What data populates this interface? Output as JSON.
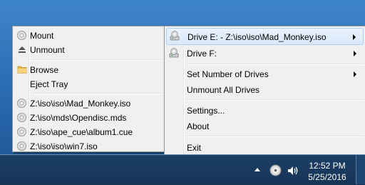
{
  "left_menu": {
    "mount": "Mount",
    "unmount": "Unmount",
    "browse": "Browse",
    "eject_tray": "Eject Tray",
    "recent": [
      "Z:\\iso\\iso\\Mad_Monkey.iso",
      "Z:\\iso\\mds\\Opendisc.mds",
      "Z:\\iso\\ape_cue\\album1.cue",
      "Z:\\iso\\iso\\win7.iso"
    ]
  },
  "right_menu": {
    "drive_e": "Drive E: - Z:\\iso\\iso\\Mad_Monkey.iso",
    "drive_f": "Drive F:",
    "set_number": "Set Number of Drives",
    "unmount_all": "Unmount All Drives",
    "settings": "Settings...",
    "about": "About",
    "exit": "Exit"
  },
  "taskbar": {
    "time": "12:52 PM",
    "date": "5/25/2016"
  },
  "icons": {
    "mount": "disc-icon",
    "unmount": "eject-icon",
    "browse": "folder-icon",
    "recent": "disc-file-icon",
    "drives": "virtual-drive-icon",
    "tray": [
      "show-hidden-icons-arrow",
      "wincdemu-tray-icon",
      "volume-icon"
    ]
  }
}
